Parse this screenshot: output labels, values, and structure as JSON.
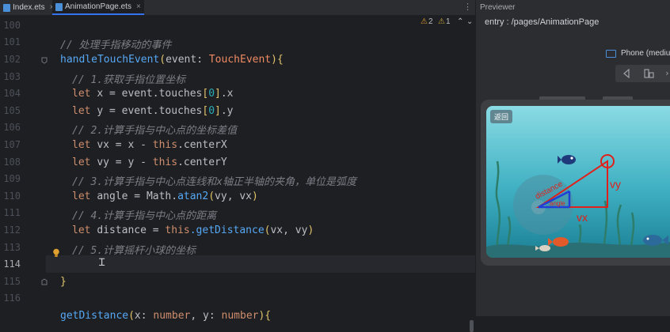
{
  "tabs": [
    {
      "label": "Index.ets",
      "active": false
    },
    {
      "label": "AnimationPage.ets",
      "active": true
    }
  ],
  "inspections": {
    "warnings": "2",
    "weak_warnings": "1"
  },
  "line_numbers": [
    "100",
    "101",
    "102",
    "103",
    "104",
    "105",
    "106",
    "107",
    "108",
    "109",
    "110",
    "111",
    "112",
    "113",
    "114",
    "115",
    "116"
  ],
  "code": {
    "l101": "// 处理手指移动的事件",
    "l102_fn": "handleTouchEvent",
    "l102_param": "event",
    "l102_type": "TouchEvent",
    "l103": "// 1.获取手指位置坐标",
    "l104_var": "x",
    "l104_expr": "event.touches",
    "l104_idx": "0",
    "l104_prop": ".x",
    "l105_var": "y",
    "l105_expr": "event.touches",
    "l105_idx": "0",
    "l105_prop": ".y",
    "l106": "// 2.计算手指与中心点的坐标差值",
    "l107_var": "vx",
    "l107_a": "x",
    "l107_this": "this",
    "l107_prop": ".centerX",
    "l108_var": "vy",
    "l108_a": "y",
    "l108_this": "this",
    "l108_prop": ".centerY",
    "l109": "// 3.计算手指与中心点连线和x轴正半轴的夹角，单位是弧度",
    "l110_var": "angle",
    "l110_obj": "Math.",
    "l110_fn": "atan2",
    "l110_args": "vy, vx",
    "l111": "// 4.计算手指与中心点的距离",
    "l112_var": "distance",
    "l112_this": "this",
    "l112_fn": ".getDistance",
    "l112_args": "vx, vy",
    "l113": "// 5.计算摇杆小球的坐标",
    "l115": "}",
    "l117_fn": "getDistance",
    "l117_p1": "x",
    "l117_t1": "number",
    "l117_p2": "y",
    "l117_t2": "number",
    "kw_let": "let"
  },
  "previewer": {
    "title": "Previewer",
    "route": "entry : /pages/AnimationPage",
    "device": "Phone (mediu",
    "back_button": "返回"
  },
  "game_labels": {
    "vx": "vx",
    "vy": "vy",
    "distance": "distance",
    "angle": "angle"
  },
  "colors": {
    "accent": "#3574f0",
    "warning": "#e0a030",
    "ocean_top": "#7fd3df",
    "ocean_bottom": "#1f8ea3",
    "triangle": "#e0201a",
    "vector": "#1f3fd6"
  }
}
